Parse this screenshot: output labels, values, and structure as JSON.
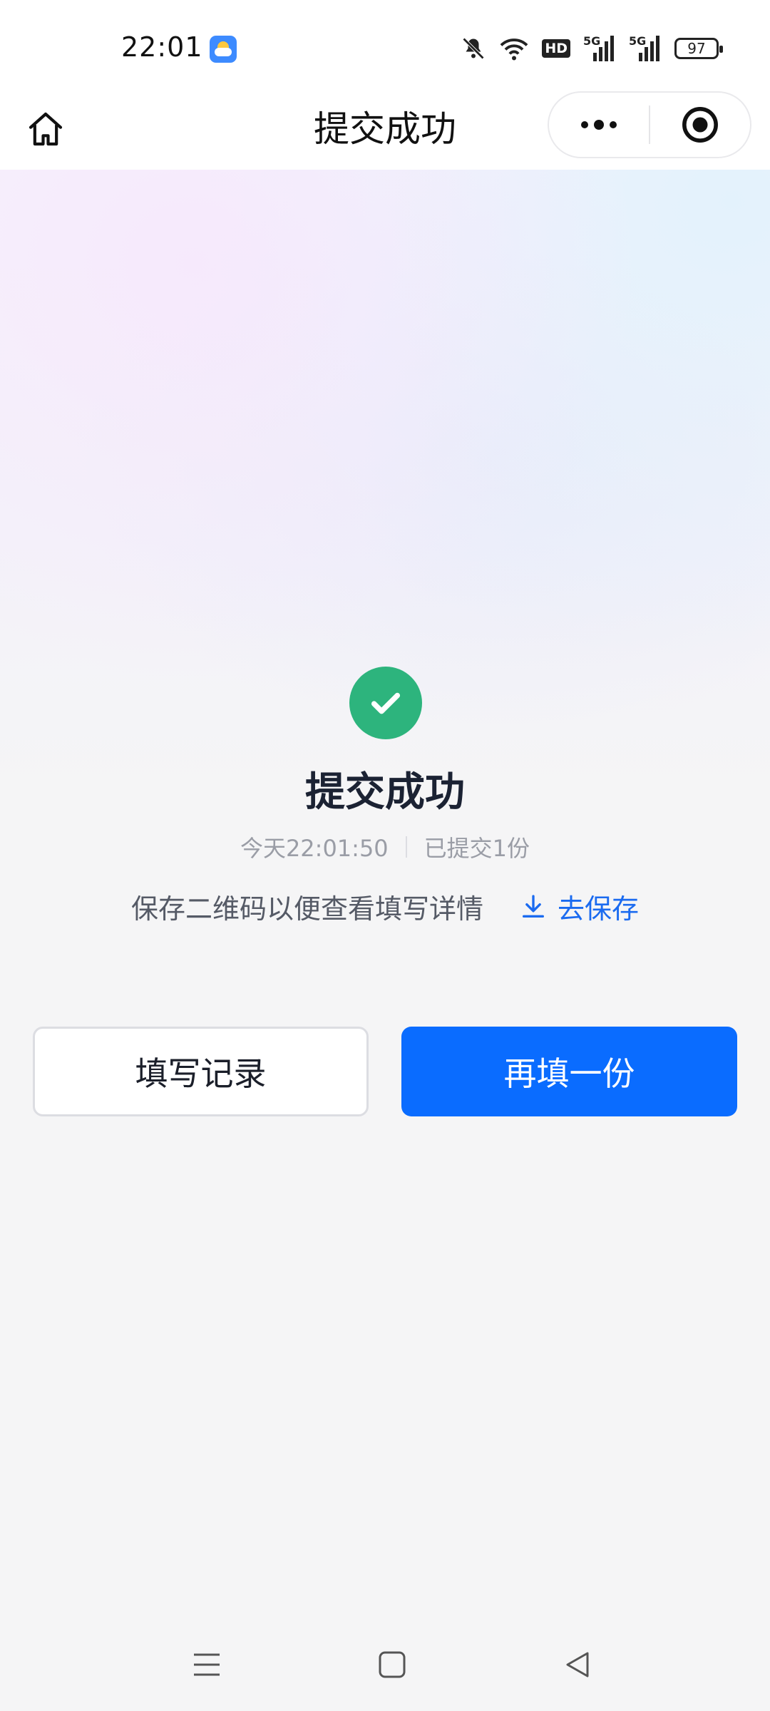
{
  "status_bar": {
    "time": "22:01",
    "icons": [
      "weather-app-icon",
      "mute-icon",
      "wifi-icon",
      "hd-icon",
      "signal-5g-icon",
      "signal-5g-icon",
      "battery-icon"
    ],
    "hd_label": "HD",
    "network_1": "5G",
    "network_2": "5G",
    "battery_level": "97"
  },
  "navbar": {
    "title": "提交成功",
    "icons": [
      "home-icon",
      "more-icon",
      "close-target-icon"
    ]
  },
  "result": {
    "icon": "check-circle-icon",
    "title": "提交成功",
    "time_text": "今天22:01:50",
    "count_text": "已提交1份",
    "save_hint": "保存二维码以便查看填写详情",
    "save_link": "去保存",
    "save_icon": "download-icon"
  },
  "buttons": {
    "record_label": "填写记录",
    "again_label": "再填一份"
  },
  "system_nav": {
    "icons": [
      "menu-icon",
      "home-square-icon",
      "back-icon"
    ]
  },
  "colors": {
    "accent": "#0a6cff",
    "success": "#2db47d",
    "link": "#1b6bf0"
  }
}
